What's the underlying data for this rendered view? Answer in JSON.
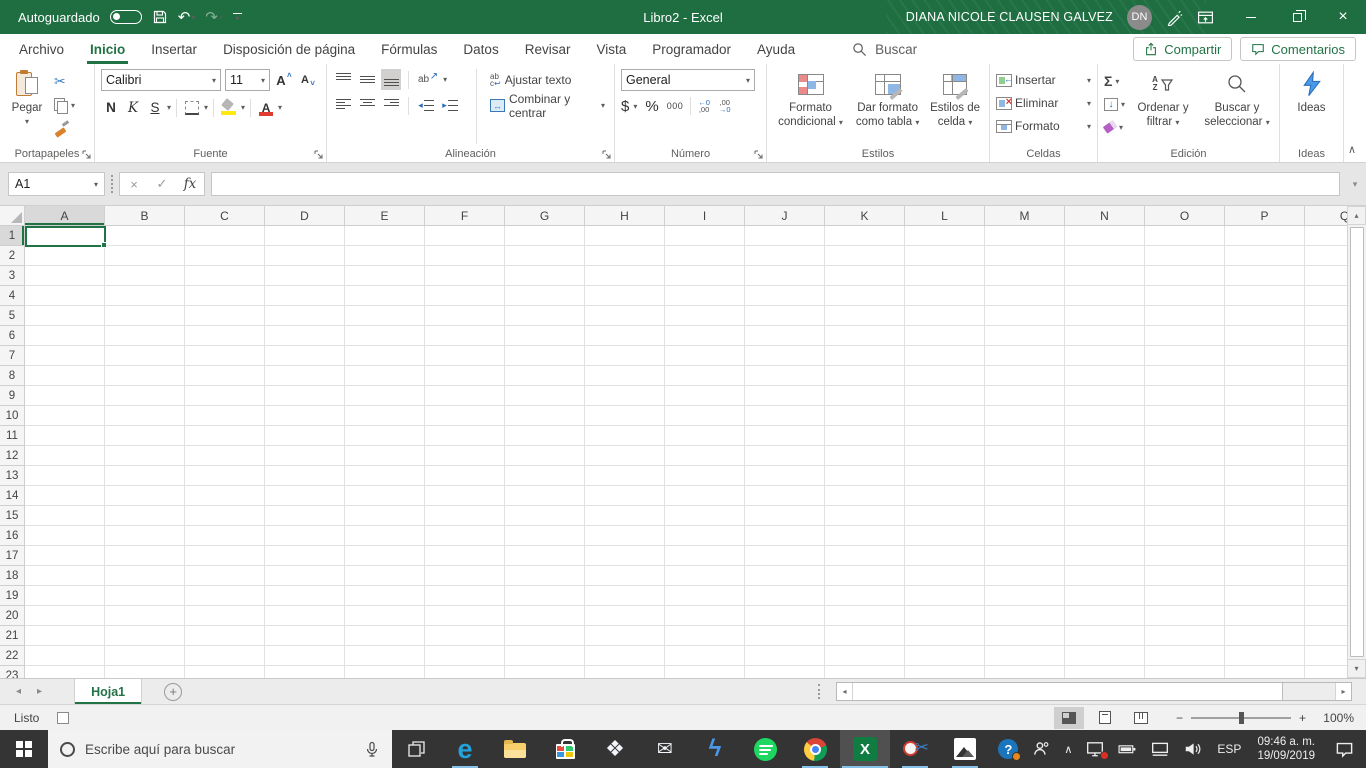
{
  "titlebar": {
    "autosave_label": "Autoguardado",
    "autosave_state": "off",
    "title": "Libro2  -  Excel",
    "user_name": "DIANA NICOLE CLAUSEN GALVEZ",
    "avatar_initials": "DN"
  },
  "tab_bar": {
    "tabs": [
      "Archivo",
      "Inicio",
      "Insertar",
      "Disposición de página",
      "Fórmulas",
      "Datos",
      "Revisar",
      "Vista",
      "Programador",
      "Ayuda"
    ],
    "active_tab": "Inicio",
    "search_label": "Buscar",
    "share_button": "Compartir",
    "comments_button": "Comentarios"
  },
  "ribbon": {
    "clipboard": {
      "label": "Portapapeles",
      "paste": "Pegar"
    },
    "font": {
      "label": "Fuente",
      "font_name": "Calibri",
      "font_size": "11",
      "bold": "N",
      "italic": "K",
      "underline": "S"
    },
    "alignment": {
      "label": "Alineación",
      "wrap_text": "Ajustar texto",
      "merge_center": "Combinar y centrar"
    },
    "number": {
      "label": "Número",
      "format": "General",
      "currency": "$",
      "percent": "%",
      "thousands": "000"
    },
    "styles": {
      "label": "Estilos",
      "conditional_line1": "Formato",
      "conditional_line2": "condicional",
      "table_line1": "Dar formato",
      "table_line2": "como tabla",
      "cellstyles_line1": "Estilos de",
      "cellstyles_line2": "celda"
    },
    "cells": {
      "label": "Celdas",
      "insert": "Insertar",
      "delete": "Eliminar",
      "format": "Formato"
    },
    "editing": {
      "label": "Edición",
      "sort_line1": "Ordenar y",
      "sort_line2": "filtrar",
      "find_line1": "Buscar y",
      "find_line2": "seleccionar"
    },
    "ideas": {
      "label": "Ideas",
      "button": "Ideas"
    }
  },
  "formula_bar": {
    "name_box": "A1",
    "fx": "fx"
  },
  "grid": {
    "columns": [
      "A",
      "B",
      "C",
      "D",
      "E",
      "F",
      "G",
      "H",
      "I",
      "J",
      "K",
      "L",
      "M",
      "N",
      "O",
      "P",
      "Q"
    ],
    "row_count": 23,
    "selected_cell": "A1",
    "selected_column": "A",
    "selected_row": "1"
  },
  "sheet_bar": {
    "active_sheet": "Hoja1"
  },
  "status_bar": {
    "status": "Listo",
    "zoom_level": "100%"
  },
  "taskbar": {
    "search_placeholder": "Escribe aquí para buscar",
    "language": "ESP",
    "time": "09:46 a. m.",
    "date": "19/09/2019",
    "apps": [
      {
        "name": "edge",
        "running": true
      },
      {
        "name": "file-explorer",
        "running": false
      },
      {
        "name": "store",
        "running": false
      },
      {
        "name": "dropbox",
        "running": false
      },
      {
        "name": "mail",
        "running": false
      },
      {
        "name": "lightning-app",
        "running": false
      },
      {
        "name": "spotify",
        "running": false
      },
      {
        "name": "chrome",
        "running": true
      },
      {
        "name": "excel",
        "running": true,
        "active": true
      },
      {
        "name": "snipping-tool",
        "running": true
      },
      {
        "name": "photos",
        "running": true
      }
    ]
  },
  "icons": {
    "undo": "↶",
    "redo": "↷",
    "dropdown": "▾",
    "scissors": "✂",
    "close": "×",
    "cancel": "×",
    "check": "✓",
    "sigma": "Σ",
    "fill_down": "↓",
    "sheet_prev": "◂",
    "sheet_next": "▸",
    "add_sheet": "+",
    "scroll_up": "▴",
    "scroll_down": "▾",
    "scroll_left": "◂",
    "scroll_right": "▸",
    "minus": "−",
    "plus": "+",
    "collapse_ribbon": "∧",
    "tray_chevron": "∧",
    "font_color_letter": "A",
    "grow_font": "A",
    "shrink_font": "A",
    "orientation_ab": "ab",
    "orientation_arrow": "↗",
    "wrap_ab": "ab",
    "wrap_c": "c",
    "wrap_return": "↩",
    "merge_arrows": "↔",
    "inc_dec_top": "←0",
    "inc_dec_bottom": ",00",
    "dec_dec_top": ",00",
    "dec_dec_bottom": "→0",
    "sort_a": "A",
    "sort_z": "Z",
    "dropbox": "❖",
    "mail": "✉",
    "lightning": "ϟ",
    "edge": "e",
    "excel_x": "X",
    "snip_scissors": "✂",
    "question": "?"
  },
  "colors": {
    "excel_green": "#1e6e42",
    "accent_green": "#217346",
    "selection_border": "#217346",
    "taskbar": "#343434",
    "running_indicator": "#85c1e9",
    "fill_yellow": "#ffe812",
    "font_red": "#e03c32"
  }
}
